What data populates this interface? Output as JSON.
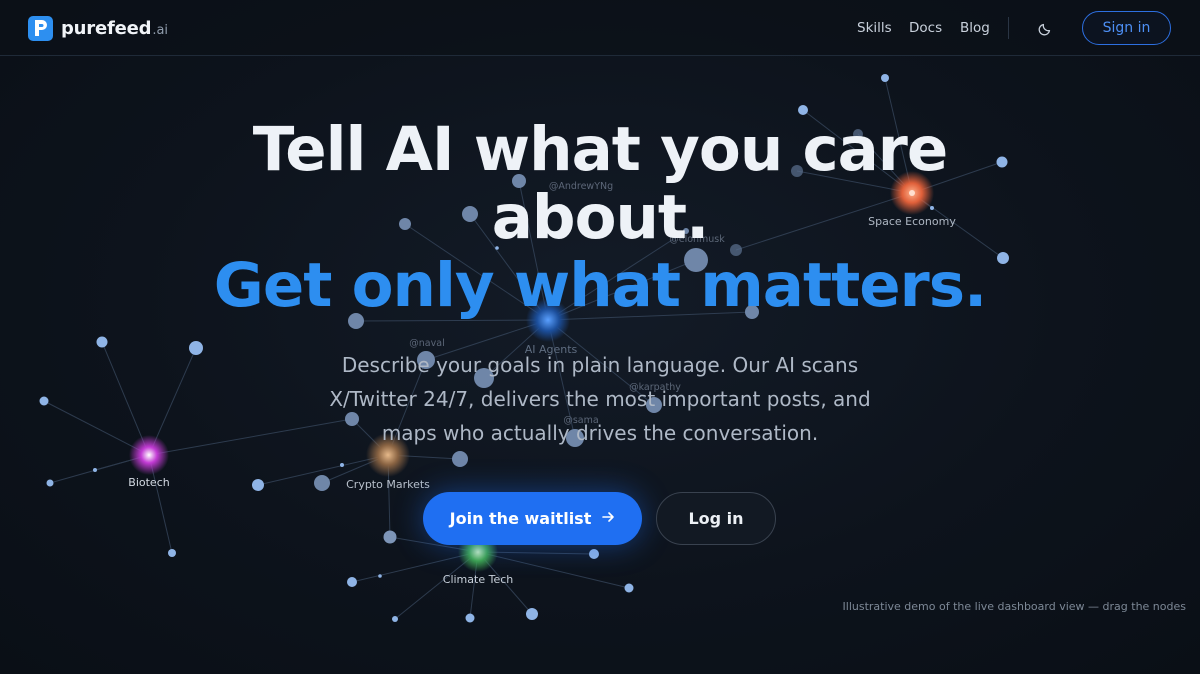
{
  "brand": {
    "name": "purefeed",
    "tld": ".ai",
    "logo_icon": "p-logo-icon",
    "accent": "#2d8ff0"
  },
  "nav": {
    "links": [
      "Skills",
      "Docs",
      "Blog"
    ],
    "theme_icon": "moon-icon",
    "signin_label": "Sign in"
  },
  "hero": {
    "headline": "Tell AI what you care about.",
    "headline_accent": "Get only what matters.",
    "subtext": "Describe your goals in plain language. Our AI scans X/Twitter 24/7, delivers the most important posts, and maps who actually drives the conversation.",
    "primary_cta": "Join the waitlist",
    "primary_cta_icon": "arrow-right-icon",
    "secondary_cta": "Log in"
  },
  "graph": {
    "topics": [
      {
        "label": "Space Economy",
        "color": "#e0603a"
      },
      {
        "label": "Biotech",
        "color": "#c23bd4"
      },
      {
        "label": "Crypto Markets",
        "color": "#b88654"
      },
      {
        "label": "Climate Tech",
        "color": "#3fa44a"
      },
      {
        "label": "AI Agents",
        "color": "#2d6fe0"
      }
    ],
    "handles": [
      "@AndrewYNg",
      "@elonmusk",
      "@naval",
      "@karpathy",
      "@sama"
    ]
  },
  "caption": "Illustrative demo of the live dashboard view — drag the nodes",
  "colors": {
    "accent": "#2d8ef0",
    "button": "#1f6ff2",
    "node": "#8fb4e6"
  }
}
